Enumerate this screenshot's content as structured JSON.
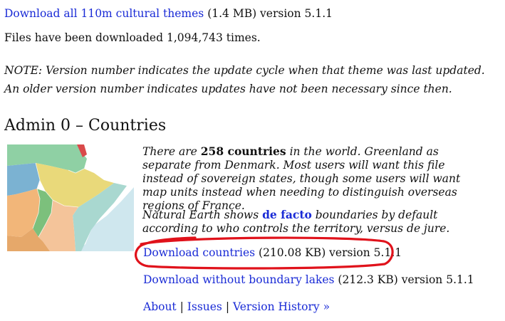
{
  "top": {
    "download_all_link": "Download all 110m cultural themes",
    "download_all_meta": " (1.4 MB) version 5.1.1",
    "download_count_text": "Files have been downloaded 1,094,743 times."
  },
  "note": {
    "text": "NOTE: Version number indicates the update cycle when that theme was last updated. An older version number indicates updates have not been necessary since then."
  },
  "section": {
    "title": "Admin 0 – Countries",
    "thumbnail_icon": "countries-map-thumbnail",
    "desc1_prefix": "There are ",
    "desc1_count": "258 countries",
    "desc1_rest": " in the world. Greenland as separate from Denmark. Most users will want this file instead of sovereign states, though some users will want map units instead when needing to distinguish overseas regions of France.",
    "desc2_prefix": "Natural Earth shows ",
    "desc2_link": "de facto",
    "desc2_rest": " boundaries by default according to who controls the territory, versus de jure.",
    "download_countries_link": "Download countries",
    "download_countries_meta": " (210.08 KB) version 5.1.1",
    "download_no_lakes_link": "Download without boundary lakes",
    "download_no_lakes_meta": " (212.3 KB) version 5.1.1",
    "footer": {
      "about": "About",
      "sep1": " | ",
      "issues": "Issues",
      "sep2": " | ",
      "version_history": "Version History »"
    }
  },
  "annotation": {
    "highlight_color": "#e0121b"
  }
}
